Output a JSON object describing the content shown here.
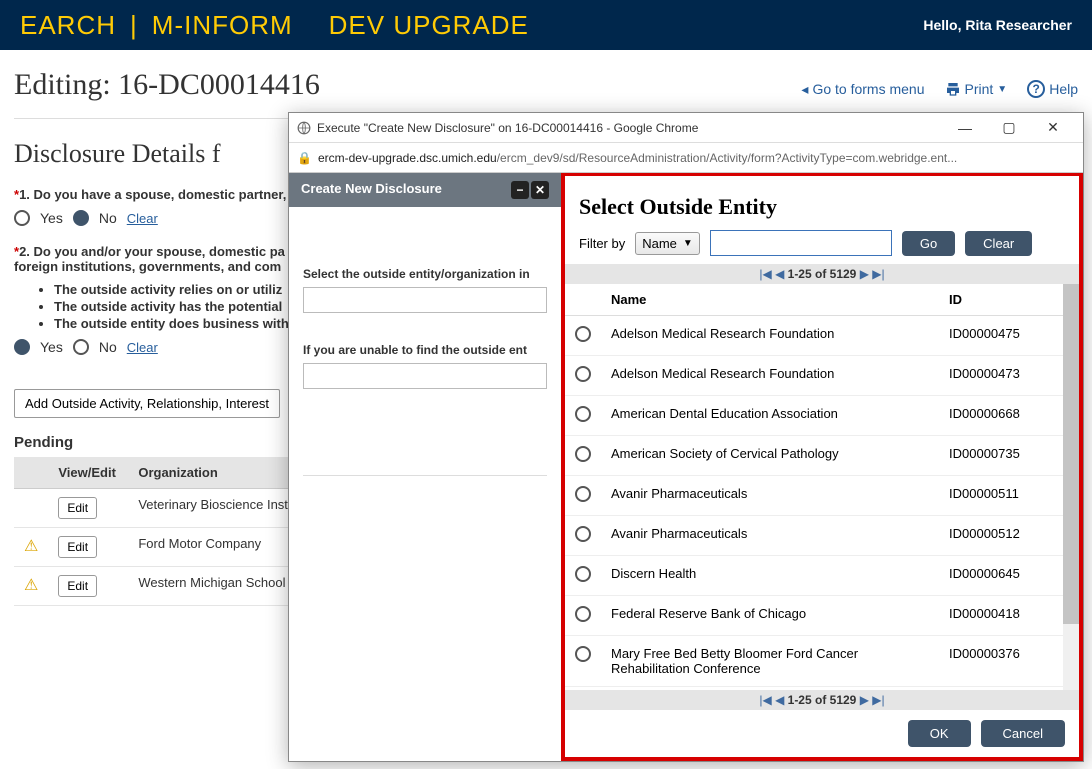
{
  "banner": {
    "brand_left": "EARCH",
    "brand_mid": "M-INFORM",
    "brand_right": "DEV UPGRADE",
    "greeting": "Hello, Rita Researcher"
  },
  "top": {
    "editing": "Editing: 16-DC00014416",
    "forms_menu": "Go to forms menu",
    "print": "Print",
    "help": "Help"
  },
  "section_heading": "Disclosure Details f",
  "q1": {
    "text": "1. Do you have a spouse, domestic partner,",
    "yes": "Yes",
    "no": "No",
    "clear": "Clear"
  },
  "q2": {
    "text": "2. Do you and/or your spouse, domestic pa",
    "text2": "foreign institutions, governments, and com",
    "bullets": [
      "The outside activity relies on or utiliz",
      "The outside activity has the potential",
      "The outside entity does business with"
    ],
    "yes": "Yes",
    "no": "No",
    "clear": "Clear"
  },
  "add_btn": "Add Outside Activity, Relationship, Interest",
  "pending": {
    "heading": "Pending",
    "col_view": "View/Edit",
    "col_org": "Organization",
    "rows": [
      {
        "warn": false,
        "org": "Veterinary Bioscience Institute"
      },
      {
        "warn": true,
        "org": "Ford Motor Company"
      },
      {
        "warn": true,
        "org": "Western Michigan School of Medicine"
      }
    ],
    "edit_label": "Edit"
  },
  "popup": {
    "chrome_title": "Execute \"Create New Disclosure\" on 16-DC00014416 - Google Chrome",
    "url_dark": "ercm-dev-upgrade.dsc.umich.edu",
    "url_light": "/ercm_dev9/sd/ResourceAdministration/Activity/form?ActivityType=com.webridge.ent...",
    "left_header": "Create New Disclosure",
    "left_prompt1": "Select the outside entity/organization in",
    "left_prompt2": "If you are unable to find the outside ent",
    "soe_title": "Select Outside Entity",
    "filter_label": "Filter by",
    "filter_dropdown": "Name",
    "go": "Go",
    "clear": "Clear",
    "pager": "1-25 of 5129",
    "col_name": "Name",
    "col_id": "ID",
    "ok": "OK",
    "cancel": "Cancel",
    "entities": [
      {
        "name": "Adelson Medical Research Foundation",
        "id": "ID00000475"
      },
      {
        "name": "Adelson Medical Research Foundation",
        "id": "ID00000473"
      },
      {
        "name": "American Dental Education Association",
        "id": "ID00000668"
      },
      {
        "name": "American Society of Cervical Pathology",
        "id": "ID00000735"
      },
      {
        "name": "Avanir Pharmaceuticals",
        "id": "ID00000511"
      },
      {
        "name": "Avanir Pharmaceuticals",
        "id": "ID00000512"
      },
      {
        "name": "Discern Health",
        "id": "ID00000645"
      },
      {
        "name": "Federal Reserve Bank of Chicago",
        "id": "ID00000418"
      },
      {
        "name": "Mary Free Bed Betty Bloomer Ford Cancer Rehabilitation Conference",
        "id": "ID00000376"
      }
    ]
  }
}
